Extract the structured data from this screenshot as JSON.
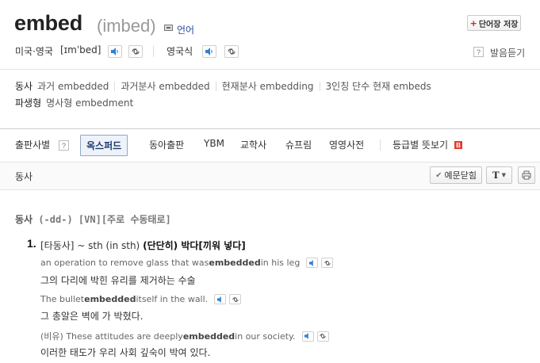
{
  "header": {
    "word": "embed",
    "pronunciation": "(imbed)",
    "lang_label": "언어",
    "save_label": "단어장 저장"
  },
  "pron_row": {
    "us_label": "미국·영국",
    "us_ipa": "[ɪmˈbed]",
    "uk_label": "영국식",
    "listen_label": "발음듣기"
  },
  "forms": {
    "verb_label": "동사",
    "items": [
      {
        "name": "과거",
        "value": "embedded"
      },
      {
        "name": "과거분사",
        "value": "embedded"
      },
      {
        "name": "현재분사",
        "value": "embedding"
      },
      {
        "name": "3인칭 단수 현재",
        "value": "embeds"
      }
    ],
    "derived_label": "파생형",
    "derived_name": "명사형",
    "derived_value": "embedment"
  },
  "tabs": [
    {
      "label": "출판사별"
    },
    {
      "label": "옥스퍼드"
    },
    {
      "label": "동아출판"
    },
    {
      "label": "YBM"
    },
    {
      "label": "교학사"
    },
    {
      "label": "슈프림"
    },
    {
      "label": "영영사전"
    },
    {
      "label": "등급별 뜻보기"
    }
  ],
  "tab_badge": "B",
  "subbar": {
    "pos": "동사",
    "example_btn": "예문닫힘",
    "font_btn": "T"
  },
  "entry": {
    "pos_heading": "동사",
    "pos_grammar": "(-dd-)",
    "pos_pattern": "[VN][주로 수동태로]",
    "sense_number": "1.",
    "sense_tag": "[타동사]",
    "sense_pattern": "~ sth (in sth)",
    "sense_def": "(단단히) 박다[끼워 넣다]",
    "examples": [
      {
        "en_before": "an operation to remove glass that was ",
        "en_bold": "embedded",
        "en_after": " in his leg",
        "ko": "그의 다리에 박힌 유리를 제거하는 수술"
      },
      {
        "en_before": "The bullet ",
        "en_bold": "embedded",
        "en_after": " itself in the wall.",
        "ko": "그 총알은 벽에 가 박혔다."
      },
      {
        "en_before": "(비유) These attitudes are deeply ",
        "en_bold": "embedded",
        "en_after": " in our society.",
        "ko": "이러한 태도가 우리 사회 깊숙이 박여 있다."
      }
    ]
  }
}
